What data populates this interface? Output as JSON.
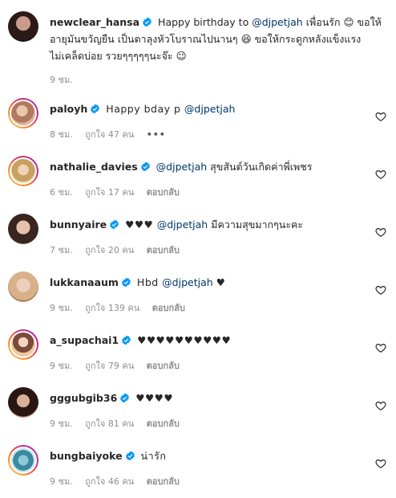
{
  "post": {
    "username": "newclear_hansa",
    "line1_pre": "Happy birthday to ",
    "line1_mention": "@djpetjah",
    "line1_post": " เพื่อนรัก 😊 ขอให้",
    "line2": "อายุมันขวัญยืน เป็นตาลุงหัวโบราณไปนานๆ 😆 ขอให้กระดูกหลังแข็งแรง",
    "line3": "ไม่เคล็ดบ่อย รวยๆๆๆๆๆนะจ๊ะ 😉",
    "time": "9 ชม."
  },
  "comments": [
    {
      "username": "paloyh",
      "pre": "Happy bday p ",
      "mention": "@djpetjah",
      "post": "",
      "time": "8 ชม.",
      "likes": "ถูกใจ 47 คน",
      "reply": "",
      "more": "•••"
    },
    {
      "username": "nathalie_davies",
      "pre": "",
      "mention": "@djpetjah",
      "post": " สุขสันต์วันเกิดค่าพี่เพชร",
      "time": "6 ชม.",
      "likes": "ถูกใจ 17 คน",
      "reply": "ตอบกลับ",
      "more": ""
    },
    {
      "username": "bunnyaire",
      "pre": "♥♥♥ ",
      "mention": "@djpetjah",
      "post": " มีความสุขมากๆนะคะ",
      "time": "7 ชม.",
      "likes": "ถูกใจ 20 คน",
      "reply": "ตอบกลับ",
      "more": ""
    },
    {
      "username": "lukkanaaum",
      "pre": "Hbd ",
      "mention": "@djpetjah",
      "post": " ♥",
      "time": "9 ชม.",
      "likes": "ถูกใจ 139 คน",
      "reply": "ตอบกลับ",
      "more": ""
    },
    {
      "username": "a_supachai1",
      "pre": "♥♥♥♥♥♥♥♥♥♥",
      "mention": "",
      "post": "",
      "time": "9 ชม.",
      "likes": "ถูกใจ 79 คน",
      "reply": "ตอบกลับ",
      "more": ""
    },
    {
      "username": "gggubgib36",
      "pre": "♥♥♥♥",
      "mention": "",
      "post": "",
      "time": "9 ชม.",
      "likes": "ถูกใจ 81 คน",
      "reply": "ตอบกลับ",
      "more": ""
    },
    {
      "username": "bungbaiyoke",
      "pre": "น่ารัก",
      "mention": "",
      "post": "",
      "time": "9 ชม.",
      "likes": "ถูกใจ 46 คน",
      "reply": "ตอบกลับ",
      "more": ""
    }
  ],
  "colors": {
    "verified": "#0095f6",
    "mention": "#00376b",
    "meta": "#8e8e8e"
  },
  "icons": {
    "verified": "verified-badge-icon",
    "like": "heart-outline-icon"
  }
}
